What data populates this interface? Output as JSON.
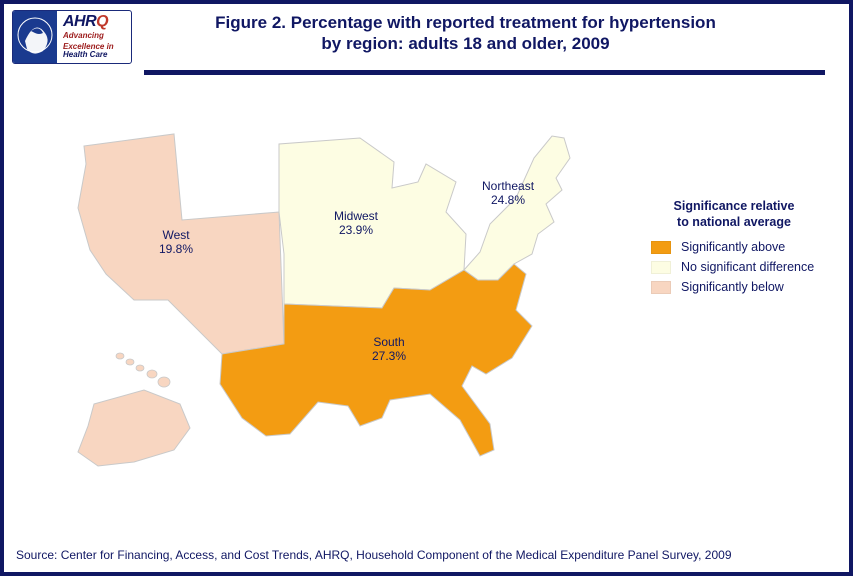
{
  "logo": {
    "brand_a": "AHR",
    "brand_q": "Q",
    "tag1": "Advancing",
    "tag2": "Excellence in",
    "tag3": "Health Care"
  },
  "title": {
    "line1": "Figure 2. Percentage with reported treatment for hypertension",
    "line2": "by region: adults 18 and older, 2009"
  },
  "legend": {
    "title_l1": "Significance relative",
    "title_l2": "to national average",
    "items": [
      {
        "label": "Significantly above",
        "color": "#f39c12"
      },
      {
        "label": "No significant difference",
        "color": "#fdfde3"
      },
      {
        "label": "Significantly below",
        "color": "#f8d6c1"
      }
    ]
  },
  "regions": {
    "west": {
      "name": "West",
      "value": "19.8%",
      "category": "Significantly below"
    },
    "midwest": {
      "name": "Midwest",
      "value": "23.9%",
      "category": "No significant difference"
    },
    "south": {
      "name": "South",
      "value": "27.3%",
      "category": "Significantly above"
    },
    "northeast": {
      "name": "Northeast",
      "value": "24.8%",
      "category": "No significant difference"
    }
  },
  "colors": {
    "above": "#f39c12",
    "same": "#fdfde3",
    "below": "#f8d6c1",
    "stroke": "#c9c9c9"
  },
  "source": "Source: Center for Financing, Access, and Cost Trends, AHRQ, Household Component of the Medical Expenditure Panel Survey, 2009",
  "chart_data": {
    "type": "map",
    "title": "Figure 2. Percentage with reported treatment for hypertension by region: adults 18 and older, 2009",
    "unit": "percent",
    "categories": [
      "West",
      "Midwest",
      "South",
      "Northeast"
    ],
    "values": [
      19.8,
      23.9,
      27.3,
      24.8
    ],
    "series": [
      {
        "name": "Reported treatment for hypertension (%)",
        "values": [
          19.8,
          23.9,
          27.3,
          24.8
        ]
      }
    ],
    "class_labels": [
      "Significantly below",
      "No significant difference",
      "Significantly above",
      "No significant difference"
    ],
    "legend_classes": [
      "Significantly above",
      "No significant difference",
      "Significantly below"
    ],
    "legend_title": "Significance relative to national average",
    "year": 2009,
    "population": "adults 18 and older"
  }
}
